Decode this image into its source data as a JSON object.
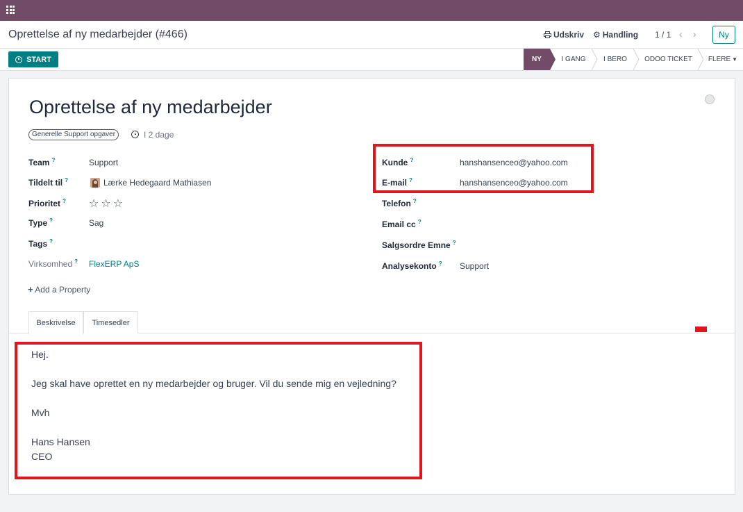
{
  "topbar": {
    "apps_icon": "apps-grid-icon"
  },
  "control": {
    "breadcrumb": "Oprettelse af ny medarbejder (#466)",
    "print_label": "Udskriv",
    "action_label": "Handling",
    "pager": "1 / 1",
    "new_label": "Ny"
  },
  "status": {
    "start_label": "START",
    "stages": [
      "NY",
      "I GANG",
      "I BERO",
      "ODOO TICKET",
      "FLERE"
    ],
    "active_stage": "NY"
  },
  "ticket": {
    "title": "Oprettelse af ny medarbejder",
    "tag": "Generelle Support opgaver",
    "deadline": "I 2 dage",
    "left_fields": [
      {
        "label": "Team",
        "value": "Support"
      },
      {
        "label": "Tildelt til",
        "value": "Lærke Hedegaard Mathiasen"
      },
      {
        "label": "Prioritet",
        "value": "☆☆☆",
        "stars_filled": 0,
        "stars_total": 3
      },
      {
        "label": "Type",
        "value": "Sag"
      },
      {
        "label": "Tags",
        "value": ""
      },
      {
        "label": "Virksomhed",
        "value": "FlexERP ApS"
      }
    ],
    "right_fields": [
      {
        "label": "Kunde",
        "value": "hanshansenceo@yahoo.com"
      },
      {
        "label": "E-mail",
        "value": "hanshansenceo@yahoo.com"
      },
      {
        "label": "Telefon",
        "value": ""
      },
      {
        "label": "Email cc",
        "value": ""
      },
      {
        "label": "Salgsordre Emne",
        "value": ""
      },
      {
        "label": "Analysekonto",
        "value": "Support"
      }
    ],
    "help_mark": "?",
    "add_property": "Add a Property"
  },
  "tabs": [
    "Beskrivelse",
    "Timesedler"
  ],
  "description": [
    "Hej.",
    "",
    "Jeg skal have oprettet en ny medarbejder og bruger. Vil du sende mig en vejledning?",
    "",
    "Mvh",
    "",
    "Hans Hansen",
    "CEO"
  ],
  "colors": {
    "brand": "#714b67",
    "accent": "#017e84",
    "highlight": "#e0161e"
  }
}
